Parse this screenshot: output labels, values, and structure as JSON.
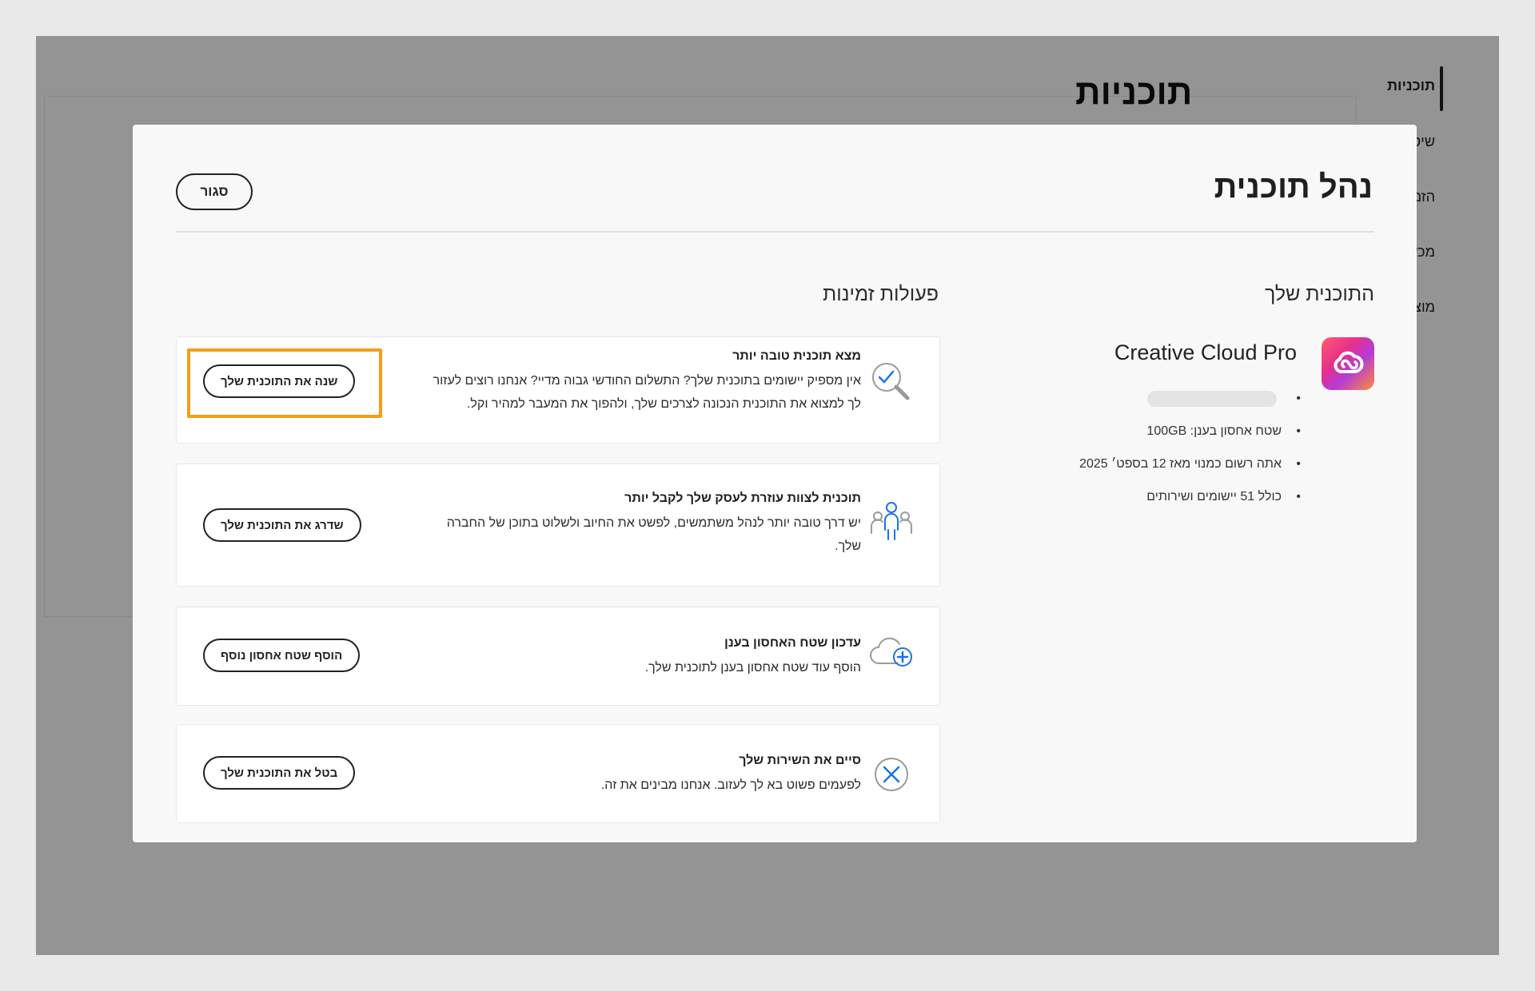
{
  "background_page": {
    "heading": "תוכניות",
    "side_nav": [
      {
        "label": "תוכניות",
        "active": true
      },
      {
        "label": "שיטות ה"
      },
      {
        "label": "הזמנות"
      },
      {
        "label": "מכשירים"
      },
      {
        "label": "מוצרים"
      }
    ]
  },
  "modal": {
    "title": "נהל תוכנית",
    "close_label": "סגור",
    "plan_section": {
      "title": "התוכנית שלך",
      "product_name": "Creative Cloud Pro",
      "features": [
        "שטח אחסון בענן: 100GB",
        "אתה רשום כמנוי מאז 12 בספט׳ 2025",
        "כולל 51 יישומים ושירותים"
      ]
    },
    "actions_section": {
      "title": "פעולות זמינות",
      "cards": [
        {
          "icon": "magnifier-check-icon",
          "title": "מצא תוכנית טובה יותר",
          "description_line1": "אין מספיק יישומים בתוכנית שלך? התשלום החודשי גבוה מדיי? אנחנו רוצים לעזור",
          "description_line2": "לך למצוא את התוכנית הנכונה לצרכים שלך, ולהפוך את המעבר למהיר וקל.",
          "button_label": "שנה את התוכנית שלך"
        },
        {
          "icon": "team-users-icon",
          "title": "תוכנית לצוות עוזרת לעסק שלך לקבל יותר",
          "description_line1": "יש דרך טובה יותר לנהל משתמשים, לפשט את החיוב ולשלוט בתוכן של החברה",
          "description_line2": "שלך.",
          "button_label": "שדרג את התוכנית שלך"
        },
        {
          "icon": "cloud-plus-icon",
          "title": "עדכון שטח האחסון בענן",
          "description_line1": "הוסף עוד שטח אחסון בענן לתוכנית שלך.",
          "button_label": "הוסף שטח אחסון נוסף"
        },
        {
          "icon": "cancel-circle-icon",
          "title": "סיים את השירות שלך",
          "description_line1": "לפעמים פשוט בא לך לעזוב. אנחנו מבינים את זה.",
          "button_label": "בטל את התוכנית שלך"
        }
      ]
    }
  },
  "colors": {
    "highlight": "#f59d1a",
    "icon_blue": "#1a73e8",
    "overlay": "rgba(0,0,0,0.42)"
  }
}
